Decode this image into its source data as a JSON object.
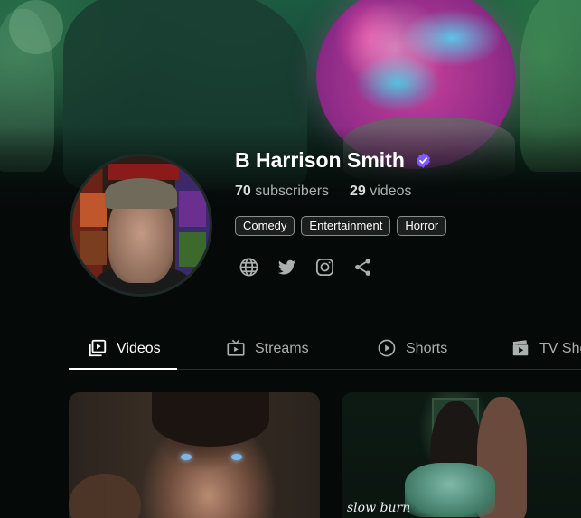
{
  "channel": {
    "name": "B Harrison Smith",
    "verified_icon": "verified-check-icon",
    "subscribers_count": "70",
    "subscribers_label": "subscribers",
    "videos_count": "29",
    "videos_label": "videos",
    "tags": [
      "Comedy",
      "Entertainment",
      "Horror"
    ],
    "socials": [
      "globe-icon",
      "twitter-icon",
      "instagram-icon",
      "share-icon"
    ]
  },
  "tabs": [
    {
      "label": "Videos",
      "icon": "video-library-icon",
      "active": true
    },
    {
      "label": "Streams",
      "icon": "tv-icon",
      "active": false
    },
    {
      "label": "Shorts",
      "icon": "play-circle-icon",
      "active": false
    },
    {
      "label": "TV Sho",
      "icon": "clapperboard-icon",
      "active": false
    }
  ],
  "thumbnails": [
    {
      "art_text": ""
    },
    {
      "art_text": "slow burn"
    }
  ],
  "colors": {
    "verified": "#7c5cff",
    "background": "#050a09",
    "tag_border": "#8a8f8d"
  }
}
